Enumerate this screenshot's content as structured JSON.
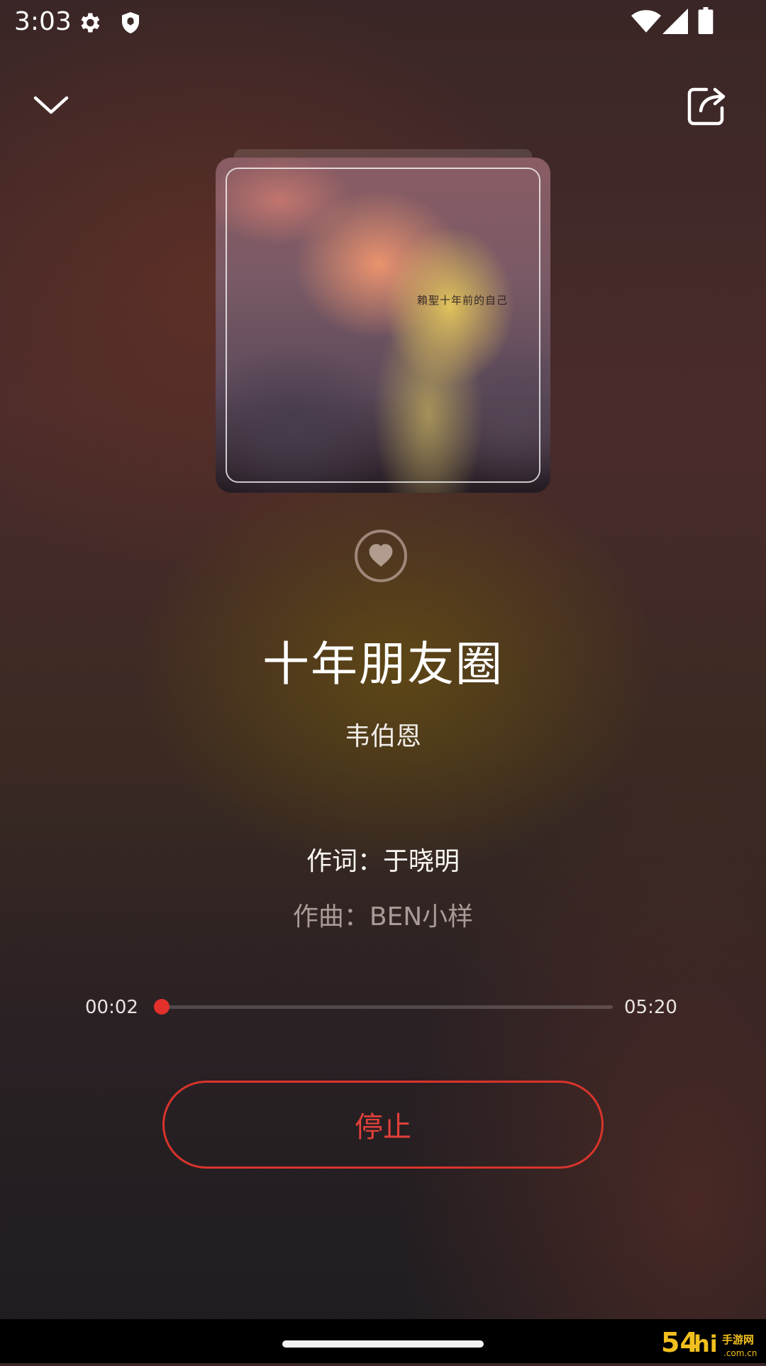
{
  "status_bar": {
    "time": "3:03",
    "icons": [
      "gear-icon",
      "shield-icon",
      "wifi-icon",
      "signal-icon",
      "battery-icon"
    ]
  },
  "header": {
    "collapse_icon": "chevron-down-icon",
    "share_icon": "share-icon"
  },
  "album": {
    "caption": "賴聖十年前的自己"
  },
  "favorite_icon": "heart-icon",
  "song": {
    "title": "十年朋友圈",
    "artist": "韦伯恩"
  },
  "lyrics": {
    "lyricist": "作词：于晓明",
    "composer": "作曲：BEN小样"
  },
  "player": {
    "current_time": "00:02",
    "total_time": "05:20",
    "progress_fraction": 0.006,
    "accent_color": "#e2302b"
  },
  "stop_button": {
    "label": "停止"
  },
  "watermark": {
    "text": "54hi手游网 .com.cn"
  }
}
